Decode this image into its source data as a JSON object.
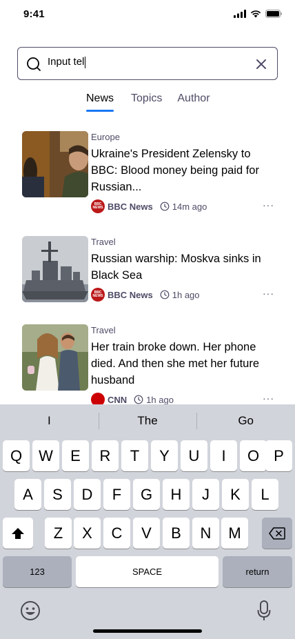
{
  "status": {
    "time": "9:41"
  },
  "search": {
    "value": "Input tel"
  },
  "tabs": [
    {
      "label": "News",
      "active": true
    },
    {
      "label": "Topics",
      "active": false
    },
    {
      "label": "Author",
      "active": false
    }
  ],
  "articles": [
    {
      "category": "Europe",
      "headline": "Ukraine's President Zelensky to BBC: Blood money being paid for Russian...",
      "source": "BBC News",
      "time_ago": "14m ago"
    },
    {
      "category": "Travel",
      "headline": "Russian warship: Moskva sinks in Black Sea",
      "source": "BBC News",
      "time_ago": "1h ago"
    },
    {
      "category": "Travel",
      "headline": "Her train broke down. Her phone died. And then she met her future husband",
      "source": "CNN",
      "time_ago": "1h ago"
    }
  ],
  "source_logos": {
    "bbc_line1": "BBC",
    "bbc_line2": "NEWS"
  },
  "more_label": "···",
  "keyboard": {
    "suggestions": [
      "I",
      "The",
      "Go"
    ],
    "row1": [
      "Q",
      "W",
      "E",
      "R",
      "T",
      "Y",
      "U",
      "I",
      "O",
      "P"
    ],
    "row2": [
      "A",
      "S",
      "D",
      "F",
      "G",
      "H",
      "J",
      "K",
      "L"
    ],
    "row3": [
      "Z",
      "X",
      "C",
      "V",
      "B",
      "N",
      "M"
    ],
    "numbers_label": "123",
    "space_label": "SPACE",
    "return_label": "return"
  },
  "colors": {
    "accent": "#1877f2",
    "bbc_red": "#bb1919",
    "cnn_red": "#cc0000",
    "keyboard_bg": "#d1d4db"
  }
}
